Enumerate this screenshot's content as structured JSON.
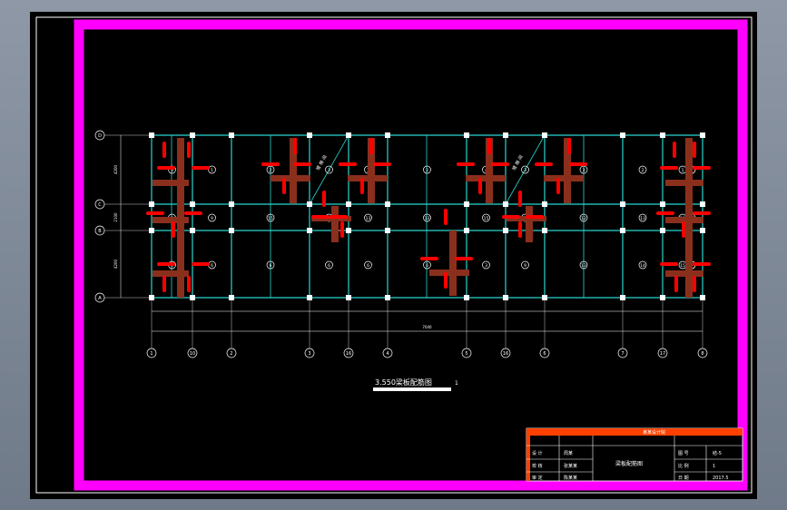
{
  "drawing": {
    "title": "3.550梁板配筋图",
    "scale_mark": "1",
    "axes_top": [
      "1",
      "10",
      "2",
      "3",
      "16",
      "4",
      "5",
      "16",
      "6",
      "7",
      "17",
      "8"
    ],
    "axes_left": [
      "D",
      "C",
      "B",
      "A"
    ],
    "slab_ids_row1": [
      "3",
      "1",
      "2",
      "3",
      "3",
      "2",
      "4",
      "3",
      "3",
      "2",
      "1",
      "2",
      "3"
    ],
    "slab_ids_row2": [
      "8",
      "9",
      "15",
      "10",
      "13",
      "13",
      "15",
      "15",
      "12",
      "13",
      "16",
      "14"
    ],
    "slab_ids_row3": [
      "3",
      "6",
      "6",
      "6",
      "6",
      "6",
      "3",
      "9",
      "13",
      "14",
      "15",
      "6",
      "3"
    ],
    "stair_label": "楼 梯 间",
    "dim_left": [
      "4200",
      "2100",
      "4200"
    ],
    "dim_bottom_total": "7040"
  },
  "title_block": {
    "drawing_name": "梁板配筋图",
    "header": "某某设计院",
    "rows": [
      {
        "label": "设 计",
        "value": "周某"
      },
      {
        "label": "校 核",
        "value": "张某某"
      },
      {
        "label": "审 定",
        "value": "陈某某"
      }
    ],
    "right_labels": [
      "图 号",
      "比 例",
      "日 期"
    ],
    "right_values": [
      "结-5",
      "1",
      "2017.5"
    ]
  },
  "colors": {
    "sheet_bg": "#000000",
    "frame": "#ff00ff",
    "grid": "#27d6cf",
    "rebar": "#ff0000",
    "beam": "#8b2f1d",
    "titleblock": "#ff4000"
  }
}
